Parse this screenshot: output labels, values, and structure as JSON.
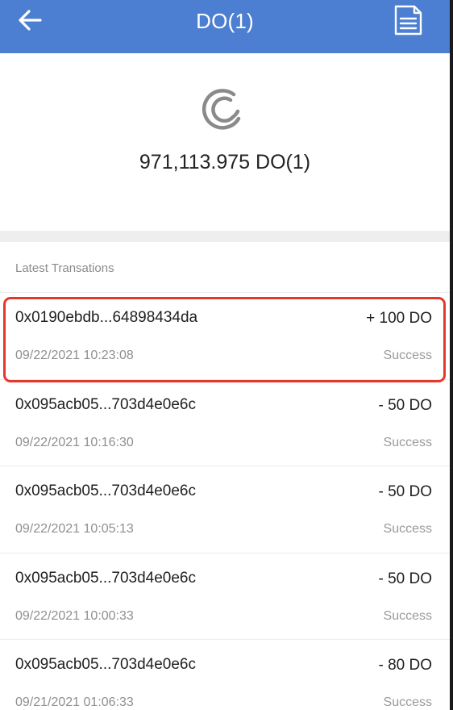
{
  "header": {
    "title": "DO(1)",
    "back_icon": "arrow-left-icon",
    "action_icon": "document-icon",
    "color": "#4c7fd1"
  },
  "balance": {
    "logo_icon": "token-logo-icon",
    "amount": "971,113.975 DO(1)"
  },
  "transactions": {
    "title": "Latest Transations",
    "items": [
      {
        "hash": "0x0190ebdb...64898434da",
        "amount": "+ 100 DO",
        "time": "09/22/2021 10:23:08",
        "status": "Success"
      },
      {
        "hash": "0x095acb05...703d4e0e6c",
        "amount": "- 50 DO",
        "time": "09/22/2021 10:16:30",
        "status": "Success"
      },
      {
        "hash": "0x095acb05...703d4e0e6c",
        "amount": "- 50 DO",
        "time": "09/22/2021 10:05:13",
        "status": "Success"
      },
      {
        "hash": "0x095acb05...703d4e0e6c",
        "amount": "- 50 DO",
        "time": "09/22/2021 10:00:33",
        "status": "Success"
      },
      {
        "hash": "0x095acb05...703d4e0e6c",
        "amount": "- 80 DO",
        "time": "09/21/2021 01:06:33",
        "status": "Success"
      }
    ]
  },
  "highlight_color": "#e5382d"
}
